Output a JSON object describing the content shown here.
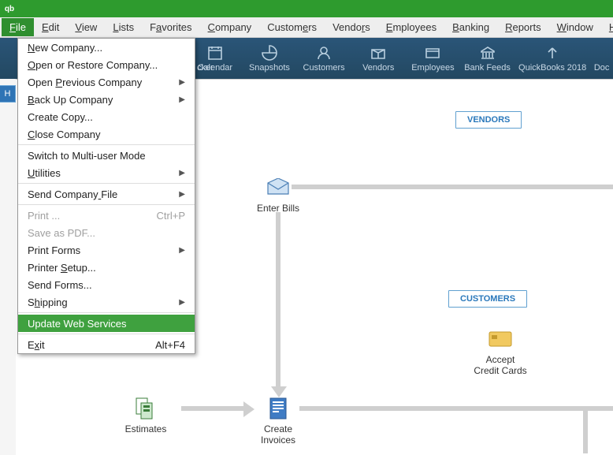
{
  "menubar": {
    "items": [
      {
        "label": "File",
        "u": 0
      },
      {
        "label": "Edit",
        "u": 0
      },
      {
        "label": "View",
        "u": 0
      },
      {
        "label": "Lists",
        "u": 0
      },
      {
        "label": "Favorites",
        "u": 1
      },
      {
        "label": "Company",
        "u": 0
      },
      {
        "label": "Customers",
        "u": 6
      },
      {
        "label": "Vendors",
        "u": 5
      },
      {
        "label": "Employees",
        "u": 0
      },
      {
        "label": "Banking",
        "u": 0
      },
      {
        "label": "Reports",
        "u": 0
      },
      {
        "label": "Window",
        "u": 0
      },
      {
        "label": "Help",
        "u": 0
      }
    ],
    "activeIndex": 0
  },
  "toolbar": {
    "items": [
      {
        "label": "cker",
        "icon": "spacer"
      },
      {
        "label": "Calendar",
        "icon": "calendar"
      },
      {
        "label": "Snapshots",
        "icon": "pie"
      },
      {
        "label": "Customers",
        "icon": "person"
      },
      {
        "label": "Vendors",
        "icon": "box"
      },
      {
        "label": "Employees",
        "icon": "card"
      },
      {
        "label": "Bank Feeds",
        "icon": "bank"
      },
      {
        "label": "QuickBooks 2018",
        "icon": "arrow"
      },
      {
        "label": "Doc",
        "icon": "cut"
      }
    ]
  },
  "sidetab": {
    "label": "H"
  },
  "fileMenu": {
    "groups": [
      [
        {
          "label": "New Company...",
          "u": 0
        },
        {
          "label": "Open or Restore Company...",
          "u": 0
        },
        {
          "label": "Open Previous Company",
          "u": 5,
          "sub": true
        },
        {
          "label": "Back Up Company",
          "u": 0,
          "sub": true
        },
        {
          "label": "Create Copy...",
          "u": -1
        },
        {
          "label": "Close Company",
          "u": 0
        }
      ],
      [
        {
          "label": "Switch to Multi-user Mode",
          "u": -1
        },
        {
          "label": "Utilities",
          "u": 0,
          "sub": true
        }
      ],
      [
        {
          "label": "Send Company File",
          "u": 12,
          "sub": true
        }
      ],
      [
        {
          "label": "Print ...",
          "u": -1,
          "disabled": true,
          "shortcut": "Ctrl+P"
        },
        {
          "label": "Save as PDF...",
          "u": -1,
          "disabled": true
        },
        {
          "label": "Print Forms",
          "u": -1,
          "sub": true
        },
        {
          "label": "Printer Setup...",
          "u": 8
        },
        {
          "label": "Send Forms...",
          "u": -1
        },
        {
          "label": "Shipping",
          "u": 1,
          "sub": true
        }
      ],
      [
        {
          "label": "Update Web Services",
          "u": -1,
          "highlight": true
        }
      ],
      [
        {
          "label": "Exit",
          "u": 1,
          "shortcut": "Alt+F4"
        }
      ]
    ]
  },
  "canvas": {
    "pills": {
      "vendors": "VENDORS",
      "customers": "CUSTOMERS"
    },
    "nodes": {
      "enterBills": "Enter Bills",
      "acceptCC1": "Accept",
      "acceptCC2": "Credit Cards",
      "estimates": "Estimates",
      "createInv1": "Create",
      "createInv2": "Invoices"
    }
  }
}
